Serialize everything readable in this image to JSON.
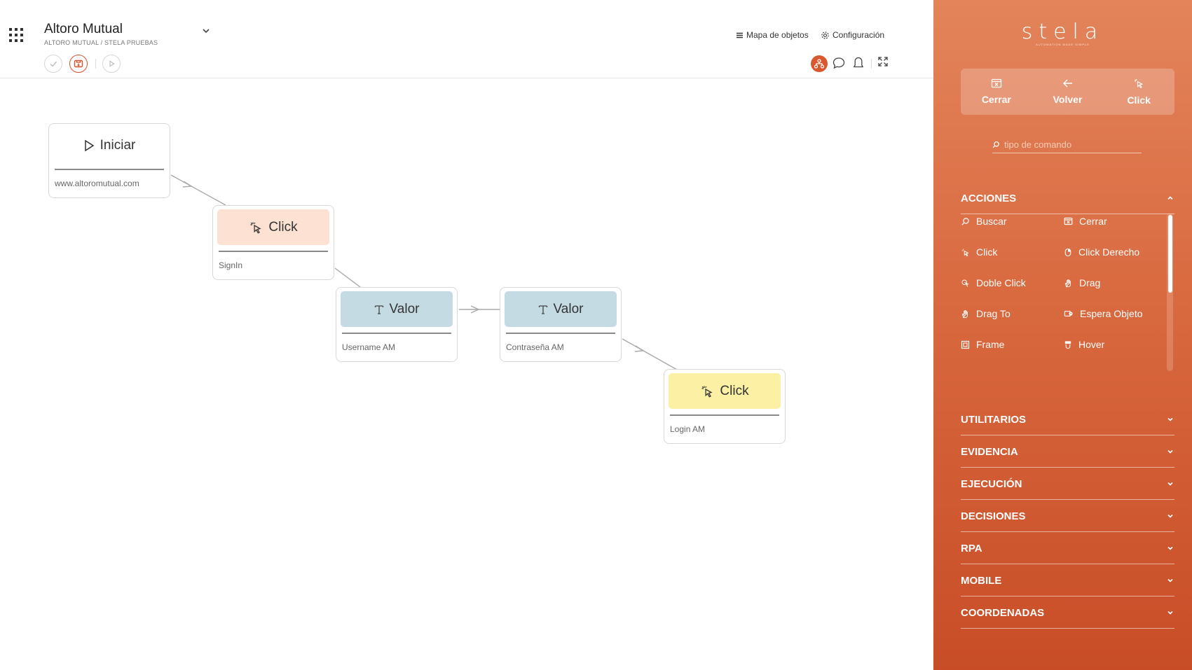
{
  "header": {
    "project_title": "Altoro Mutual",
    "breadcrumb": "ALTORO MUTUAL / STELA PRUEBAS",
    "links": {
      "map": "Mapa de objetos",
      "config": "Configuración"
    }
  },
  "flow": {
    "nodes": [
      {
        "id": "start",
        "title": "Iniciar",
        "subtitle": "www.altoromutual.com",
        "icon": "play-icon"
      },
      {
        "id": "click1",
        "title": "Click",
        "subtitle": "SignIn",
        "icon": "pointer-click-icon",
        "color": "#fde1d3"
      },
      {
        "id": "valor1",
        "title": "Valor",
        "subtitle": "Username AM",
        "icon": "text-t-icon",
        "color": "#c5dbe3"
      },
      {
        "id": "valor2",
        "title": "Valor",
        "subtitle": "Contraseña AM",
        "icon": "text-t-icon",
        "color": "#c5dbe3"
      },
      {
        "id": "click2",
        "title": "Click",
        "subtitle": "Login AM",
        "icon": "pointer-click-icon",
        "color": "#fbf0a4"
      }
    ]
  },
  "sidebar": {
    "brand": "stela",
    "tagline": "AUTOMATION MADE SIMPLE",
    "quick_actions": [
      {
        "label": "Cerrar",
        "icon": "close-window-icon"
      },
      {
        "label": "Volver",
        "icon": "arrow-left-icon"
      },
      {
        "label": "Click",
        "icon": "pointer-click-icon"
      }
    ],
    "search": {
      "placeholder": "tipo de comando"
    },
    "sections": {
      "acciones": {
        "title": "ACCIONES",
        "items": [
          {
            "label": "Buscar",
            "icon": "search-icon"
          },
          {
            "label": "Cerrar",
            "icon": "close-window-icon"
          },
          {
            "label": "Click",
            "icon": "pointer-click-icon"
          },
          {
            "label": "Click Derecho",
            "icon": "mouse-icon"
          },
          {
            "label": "Doble Click",
            "icon": "double-click-icon"
          },
          {
            "label": "Drag",
            "icon": "hand-icon"
          },
          {
            "label": "Drag To",
            "icon": "hand-icon"
          },
          {
            "label": "Espera Objeto",
            "icon": "wait-object-icon"
          },
          {
            "label": "Frame",
            "icon": "frame-icon"
          },
          {
            "label": "Hover",
            "icon": "hover-icon"
          }
        ]
      },
      "utilitarios": {
        "title": "UTILITARIOS"
      },
      "evidencia": {
        "title": "EVIDENCIA"
      },
      "ejecucion": {
        "title": "EJECUCIÓN"
      },
      "decisiones": {
        "title": "DECISIONES"
      },
      "rpa": {
        "title": "RPA"
      },
      "mobile": {
        "title": "MOBILE"
      },
      "coordenadas": {
        "title": "COORDENADAS"
      }
    }
  },
  "colors": {
    "accent": "#d9582f",
    "panel_top": "#e3845b",
    "panel_bottom": "#c84d27"
  }
}
